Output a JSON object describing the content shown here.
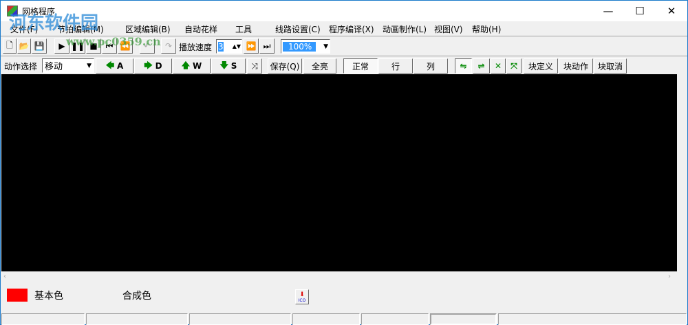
{
  "window": {
    "title": "网格程序",
    "minimize": "—",
    "maximize": "☐",
    "close": "✕"
  },
  "watermark": {
    "text": "河东软件园",
    "url": "www.pc0359.cn"
  },
  "menu": [
    "文件(F)",
    "节拍编辑(M)",
    "区域编辑(B)",
    "自动花样",
    "工具",
    "线路设置(C)",
    "程序编译(X)",
    "动画制作(L)",
    "视图(V)",
    "帮助(H)"
  ],
  "toolbar1": {
    "speed_label": "播放速度",
    "speed_value": "3",
    "zoom_value": "100%"
  },
  "toolbar2": {
    "action_label": "动作选择",
    "action_value": "移动",
    "left": "A",
    "right": "D",
    "up": "W",
    "down": "S",
    "save": "保存(Q)",
    "all_bright": "全亮",
    "normal": "正常",
    "row": "行",
    "col": "列",
    "block_define": "块定义",
    "block_action": "块动作",
    "block_cancel": "块取消"
  },
  "bottom": {
    "base_color_label": "基本色",
    "composite_color_label": "合成色",
    "base_color": "#ff0000",
    "ico_label": "ICO"
  }
}
